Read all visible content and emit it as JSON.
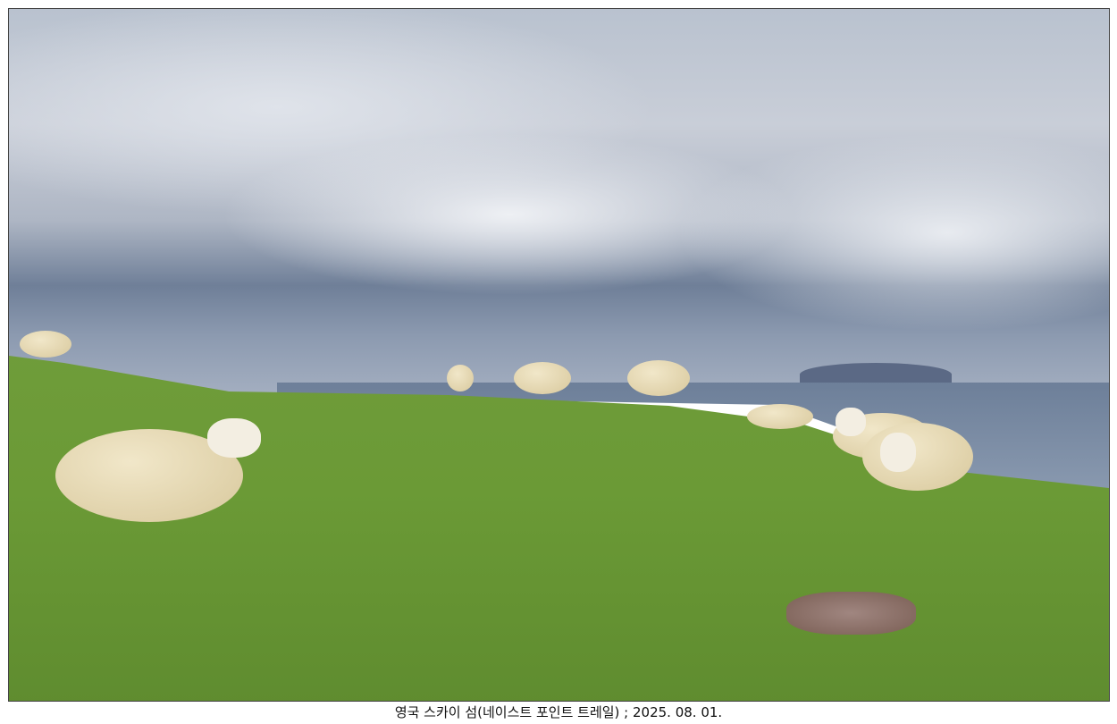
{
  "photo": {
    "subject": "sheep-on-coastal-meadow"
  },
  "caption": "영국 스카이 섬(네이스트 포인트 트레일) ; 2025. 08. 01."
}
